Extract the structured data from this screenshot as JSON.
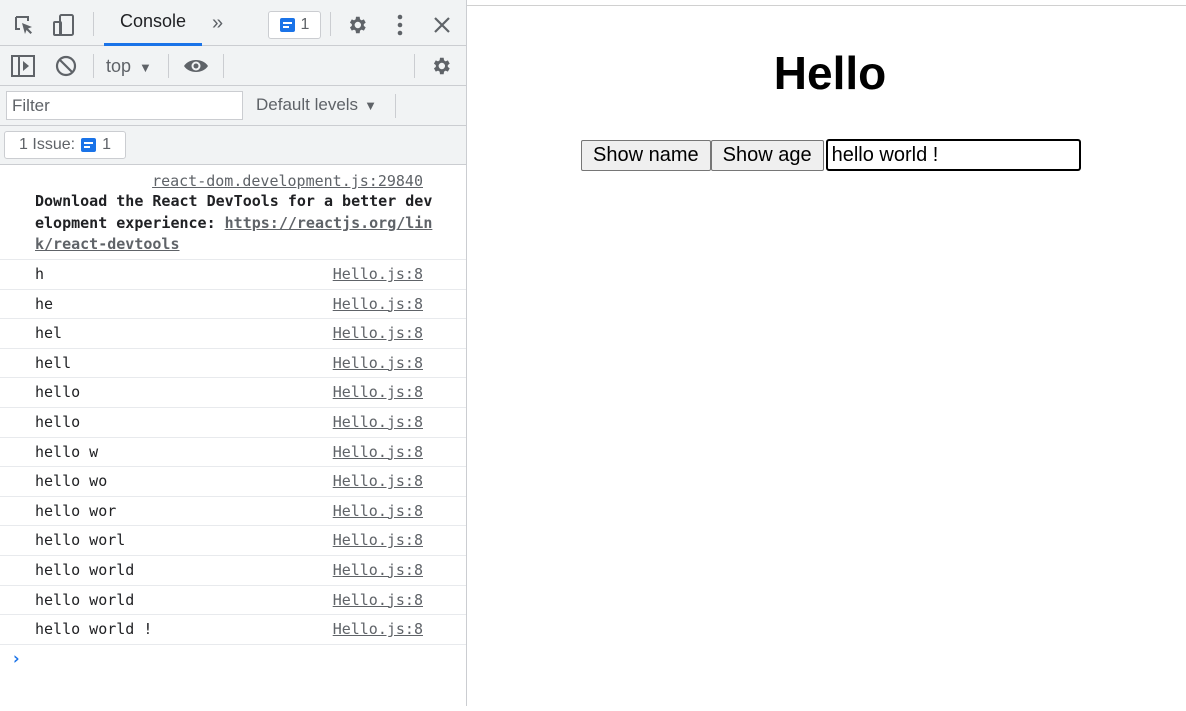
{
  "devtools": {
    "tabs": {
      "console_label": "Console",
      "more_tabs_glyph": "»",
      "issues_count": "1"
    },
    "console_toolbar": {
      "context": "top",
      "context_caret": "▼"
    },
    "filter": {
      "placeholder": "Filter",
      "levels_label": "Default levels",
      "levels_caret": "▼"
    },
    "issues": {
      "label": "1 Issue:",
      "count": "1"
    },
    "first_message": {
      "source": "react-dom.development.js:29840",
      "text": "Download the React DevTools for a better development experience: ",
      "link": "https://reactjs.org/link/react-devtools"
    },
    "log_entries": [
      {
        "text": "h",
        "source": "Hello.js:8"
      },
      {
        "text": "he",
        "source": "Hello.js:8"
      },
      {
        "text": "hel",
        "source": "Hello.js:8"
      },
      {
        "text": "hell",
        "source": "Hello.js:8"
      },
      {
        "text": "hello",
        "source": "Hello.js:8"
      },
      {
        "text": "hello",
        "source": "Hello.js:8"
      },
      {
        "text": "hello w",
        "source": "Hello.js:8"
      },
      {
        "text": "hello wo",
        "source": "Hello.js:8"
      },
      {
        "text": "hello wor",
        "source": "Hello.js:8"
      },
      {
        "text": "hello worl",
        "source": "Hello.js:8"
      },
      {
        "text": "hello world",
        "source": "Hello.js:8"
      },
      {
        "text": "hello world",
        "source": "Hello.js:8"
      },
      {
        "text": "hello world !",
        "source": "Hello.js:8"
      }
    ],
    "prompt_glyph": "›",
    "icons": {
      "inspect": "inspect-element-icon",
      "device": "device-toggle-icon",
      "settings": "gear-icon",
      "menu": "vertical-dots-icon",
      "close": "close-icon",
      "sidebar": "sidebar-toggle-icon",
      "clear": "clear-console-icon",
      "live_expression": "eye-icon",
      "console_settings": "gear-icon"
    },
    "colors": {
      "accent": "#1a73e8",
      "toolbar_bg": "#f1f3f4"
    }
  },
  "page": {
    "heading": "Hello",
    "show_name_label": "Show name",
    "show_age_label": "Show age",
    "input_value": "hello world !"
  }
}
